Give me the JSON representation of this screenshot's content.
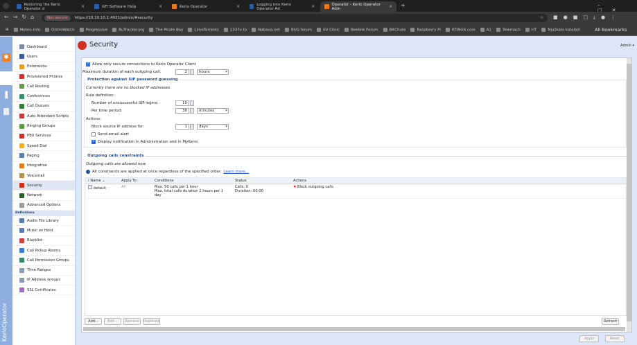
{
  "browser": {
    "tabs": [
      {
        "label": "Restoring the Kerio Operator d"
      },
      {
        "label": "GFI Software Help"
      },
      {
        "label": "Kerio Operator"
      },
      {
        "label": "Logging into Kerio Operator Ad"
      },
      {
        "label": "Operator - Kerio Operator Adm",
        "active": true
      }
    ],
    "new_tab": "+",
    "security_chip": "Not secure",
    "url": "https://10.10.10.1:4021/admin/#security",
    "bookmarks": [
      "Meteo-Info",
      "DistroWatch",
      "Progressive",
      "RuTracker.org",
      "The Pirate Bay",
      "LimeTorrents",
      "1337x.to",
      "Nabava.net",
      "BUG forum",
      "EV Clinic",
      "Beelink Forum",
      "BitChute",
      "Raspberry Pi",
      "RTINGS.com",
      "A1",
      "Telemach",
      "HT",
      "Njuškalo katalozi"
    ],
    "all_bookmarks": "All Bookmarks"
  },
  "app": {
    "brand": "KerioOperator",
    "page_title": "Security",
    "user_menu": "Admin ▾"
  },
  "sidebar": {
    "items": [
      {
        "label": "Dashboard",
        "color": "#7a8aa8"
      },
      {
        "label": "Users",
        "color": "#3a5a9a"
      },
      {
        "label": "Extensions",
        "color": "#e8a020"
      },
      {
        "label": "Provisioned Phones",
        "color": "#d03030"
      },
      {
        "label": "Call Routing",
        "color": "#6a9a50"
      },
      {
        "label": "Conferences",
        "color": "#3a8a6a"
      },
      {
        "label": "Call Queues",
        "color": "#3a7a3a"
      },
      {
        "label": "Auto Attendant Scripts",
        "color": "#c04040"
      },
      {
        "label": "Ringing Groups",
        "color": "#5a9a40"
      },
      {
        "label": "PBX Services",
        "color": "#d03030"
      },
      {
        "label": "Speed Dial",
        "color": "#f0b020"
      },
      {
        "label": "Paging",
        "color": "#5a7ab0"
      },
      {
        "label": "Integration",
        "color": "#e08020"
      },
      {
        "label": "Voicemail",
        "color": "#b09050"
      },
      {
        "label": "Security",
        "color": "#d03020",
        "selected": true
      },
      {
        "label": "Network",
        "color": "#2a5a2a"
      },
      {
        "label": "Advanced Options",
        "color": "#999999"
      }
    ],
    "definitions_header": "Definitions",
    "definitions": [
      {
        "label": "Audio File Library",
        "color": "#5a7ab0"
      },
      {
        "label": "Music on Hold",
        "color": "#5a7ab0"
      },
      {
        "label": "Blacklist",
        "color": "#d04040"
      },
      {
        "label": "Call Pickup Rooms",
        "color": "#3a7ad0"
      },
      {
        "label": "Call Permission Groups",
        "color": "#3a8a6a"
      },
      {
        "label": "Time Ranges",
        "color": "#8a9ab0"
      },
      {
        "label": "IP Address Groups",
        "color": "#8a9ab0"
      },
      {
        "label": "SSL Certificates",
        "color": "#a070c0"
      }
    ]
  },
  "form": {
    "secure_only_label": "Allow only secure connections to Kerio Operator Client",
    "max_duration_label": "Maximum duration of each outgoing call:",
    "max_duration_value": "2",
    "max_duration_unit": "hours",
    "sip": {
      "legend": "Protection against SIP password guessing",
      "status": "Currently there are no blocked IP addresses.",
      "rule_def": "Rule definition:",
      "logins_label": "Number of unsuccessful SIP logins:",
      "logins_value": "10",
      "period_label": "Per time period:",
      "period_value": "30",
      "period_unit": "minutes",
      "actions": "Actions:",
      "block_label": "Block source IP address for:",
      "block_value": "1",
      "block_unit": "days",
      "email_label": "Send email alert",
      "notify_label": "Display notification in Administration and in MyKerio"
    },
    "outgoing": {
      "legend": "Outgoing calls constraints",
      "status": "Outgoing calls are allowed now.",
      "info": "All constraints are applied at once regardless of the specified order.",
      "learn_more": "Learn more...",
      "columns": [
        "Name ⌄",
        "Apply To",
        "Conditions",
        "Status",
        "Actions"
      ],
      "rows": [
        {
          "name": "default",
          "apply_to": "All",
          "cond1": "Max. 50 calls per 1 hour",
          "cond2": "Max. total calls duration 2 hours per 1 day",
          "status1": "Calls: 0",
          "status2": "Duration: 00:00",
          "action": "Block outgoing calls"
        }
      ]
    },
    "buttons": {
      "add": "Add...",
      "edit": "Edit...",
      "remove": "Remove",
      "duplicate": "Duplicate",
      "refresh": "Refresh"
    }
  },
  "footer": {
    "apply": "Apply",
    "reset": "Reset"
  }
}
